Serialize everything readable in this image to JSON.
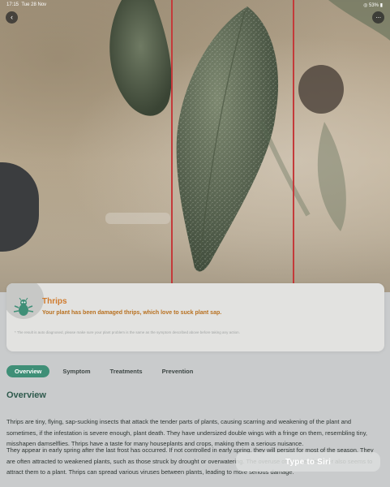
{
  "status_bar": {
    "time": "17:15",
    "date": "Tue 28 Nov",
    "battery": "53%"
  },
  "header": {
    "back_icon": "chevron-left-icon",
    "more_icon": "ellipsis-icon"
  },
  "diagnosis": {
    "name": "Thrips",
    "summary": "Your plant has been damaged thrips, which love to suck plant sap.",
    "disclaimer": "* The result is auto diagnosed, please make sure your plant problem is the same as the symptom described above before taking any action."
  },
  "tabs": [
    {
      "label": "Overview",
      "active": true
    },
    {
      "label": "Symptom",
      "active": false
    },
    {
      "label": "Treatments",
      "active": false
    },
    {
      "label": "Prevention",
      "active": false
    }
  ],
  "overview": {
    "heading": "Overview",
    "paragraph1": "Thrips are tiny, flying, sap-sucking insects that attack the tender parts of plants, causing scarring and weakening of the plant and sometimes, if the infestation is severe enough, plant death. They have undersized double wings with a fringe on them, resembling tiny, misshapen damselflies. Thrips have a taste for many houseplants and crops, making them a serious nuisance.",
    "paragraph2": "They appear in early spring after the last frost has occurred. If not controlled in early spring, they will persist for most of the season. They are often attracted to weakened plants, such as those struck by drought or overwatering. The overuse of nitrogen fertilizer also seems to attract them to a plant. Thrips can spread various viruses between plants, leading to more serious damage."
  },
  "siri": {
    "label": "Type to Siri"
  },
  "colors": {
    "accent": "#3f8f77",
    "title_orange": "#d07a2c",
    "guide_line": "#c43a3a"
  }
}
